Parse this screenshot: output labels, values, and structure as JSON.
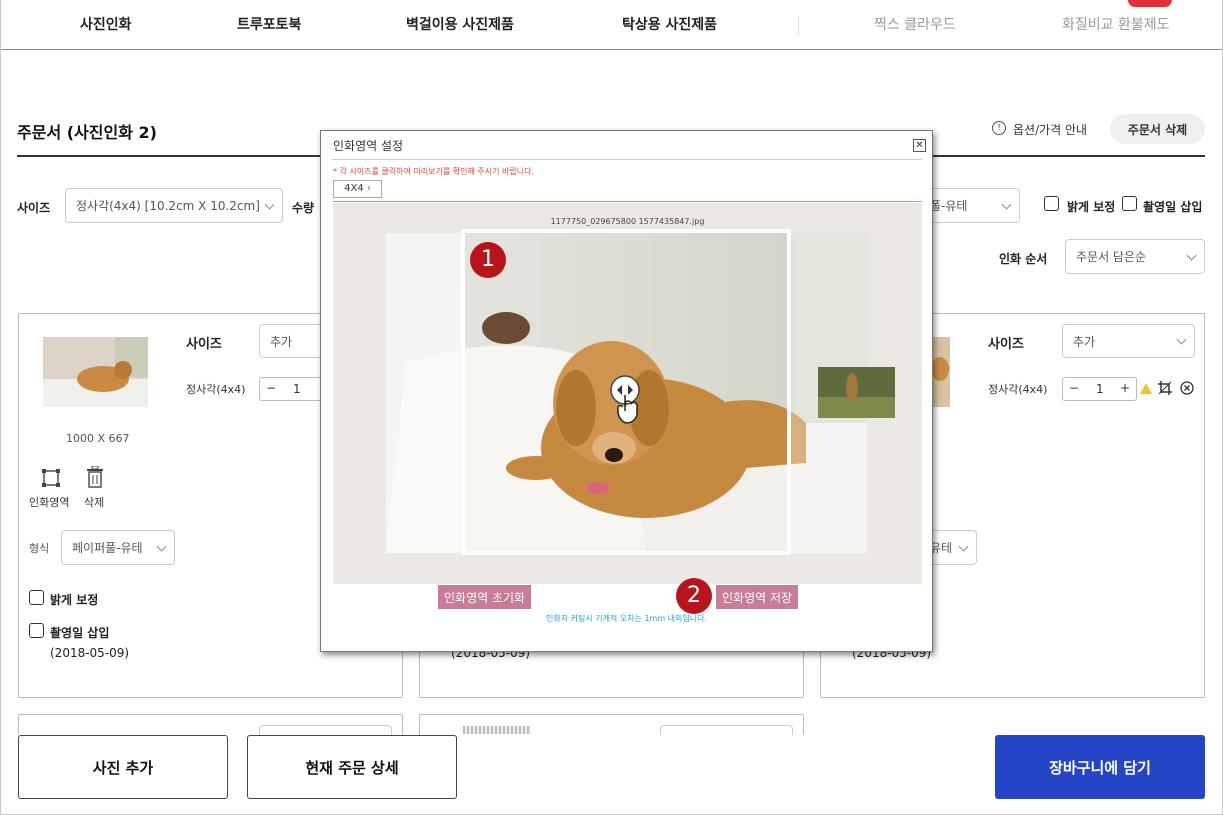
{
  "nav": {
    "items": [
      "사진인화",
      "트루포토북",
      "벽걸이용 사진제품",
      "탁상용 사진제품"
    ],
    "right_items": [
      "찍스 클라우드",
      "화질비교 환불제도"
    ]
  },
  "order": {
    "title": "주문서 (사진인화 2)",
    "info_label": "옵션/가격 안내",
    "delete_label": "주문서 삭제",
    "size_label": "사이즈",
    "size_value": "정사각(4x4)  [10.2cm X 10.2cm]",
    "qty_label": "수량",
    "format_value": "폴-유테",
    "brighten_label": "밝게 보정",
    "date_insert_label": "촬영일 삽입",
    "print_order_label": "인화 순서",
    "print_order_value": "주문서 담은순"
  },
  "card1": {
    "resolution": "1000 X 667",
    "size_label": "사이즈",
    "size_select": "추가",
    "spec": "정사각(4x4)",
    "qty": "1",
    "area_label": "인화영역",
    "delete_label": "삭제",
    "format_label": "형식",
    "format_value": "페이퍼풀-유테",
    "brighten_label": "밝게 보정",
    "date_label": "촬영일 삽입",
    "date_value": "(2018-05-09)"
  },
  "card2": {
    "date_value": "(2018-05-09)"
  },
  "card3": {
    "size_label": "사이즈",
    "size_select": "추가",
    "spec": "정사각(4x4)",
    "qty": "1",
    "format_value": "유테",
    "date_value": "(2018-05-09)"
  },
  "bottom": {
    "add_photo": "사진 추가",
    "order_detail": "현재 주문 상세",
    "cart": "장바구니에 담기"
  },
  "modal": {
    "title": "인화영역 설정",
    "close": "✕",
    "note": "* 각 사이즈를 클릭하여 미리보기를 확인해 주시기 바랍니다.",
    "tab": "4X4",
    "filename": "1177750_029675800 1577435847.jpg",
    "reset_label": "인화영역 초기화",
    "save_label": "인화영역 저장",
    "footer": "인화지 커팅시 기계적 오차는 1mm 내외입니다.",
    "badge1": "1",
    "badge2": "2"
  },
  "colors": {
    "accent": "#2445c5",
    "modal_button": "#c77c99",
    "badge": "#b8141e",
    "notice": "#d44444",
    "footer_note": "#2aa0c8"
  },
  "icons": [
    "chevron-down-icon",
    "info-icon",
    "crop-icon",
    "trash-icon",
    "warning-icon",
    "close-circle-icon",
    "move-cursor-icon",
    "hand-pointer-icon",
    "close-icon",
    "chevron-right-icon"
  ]
}
